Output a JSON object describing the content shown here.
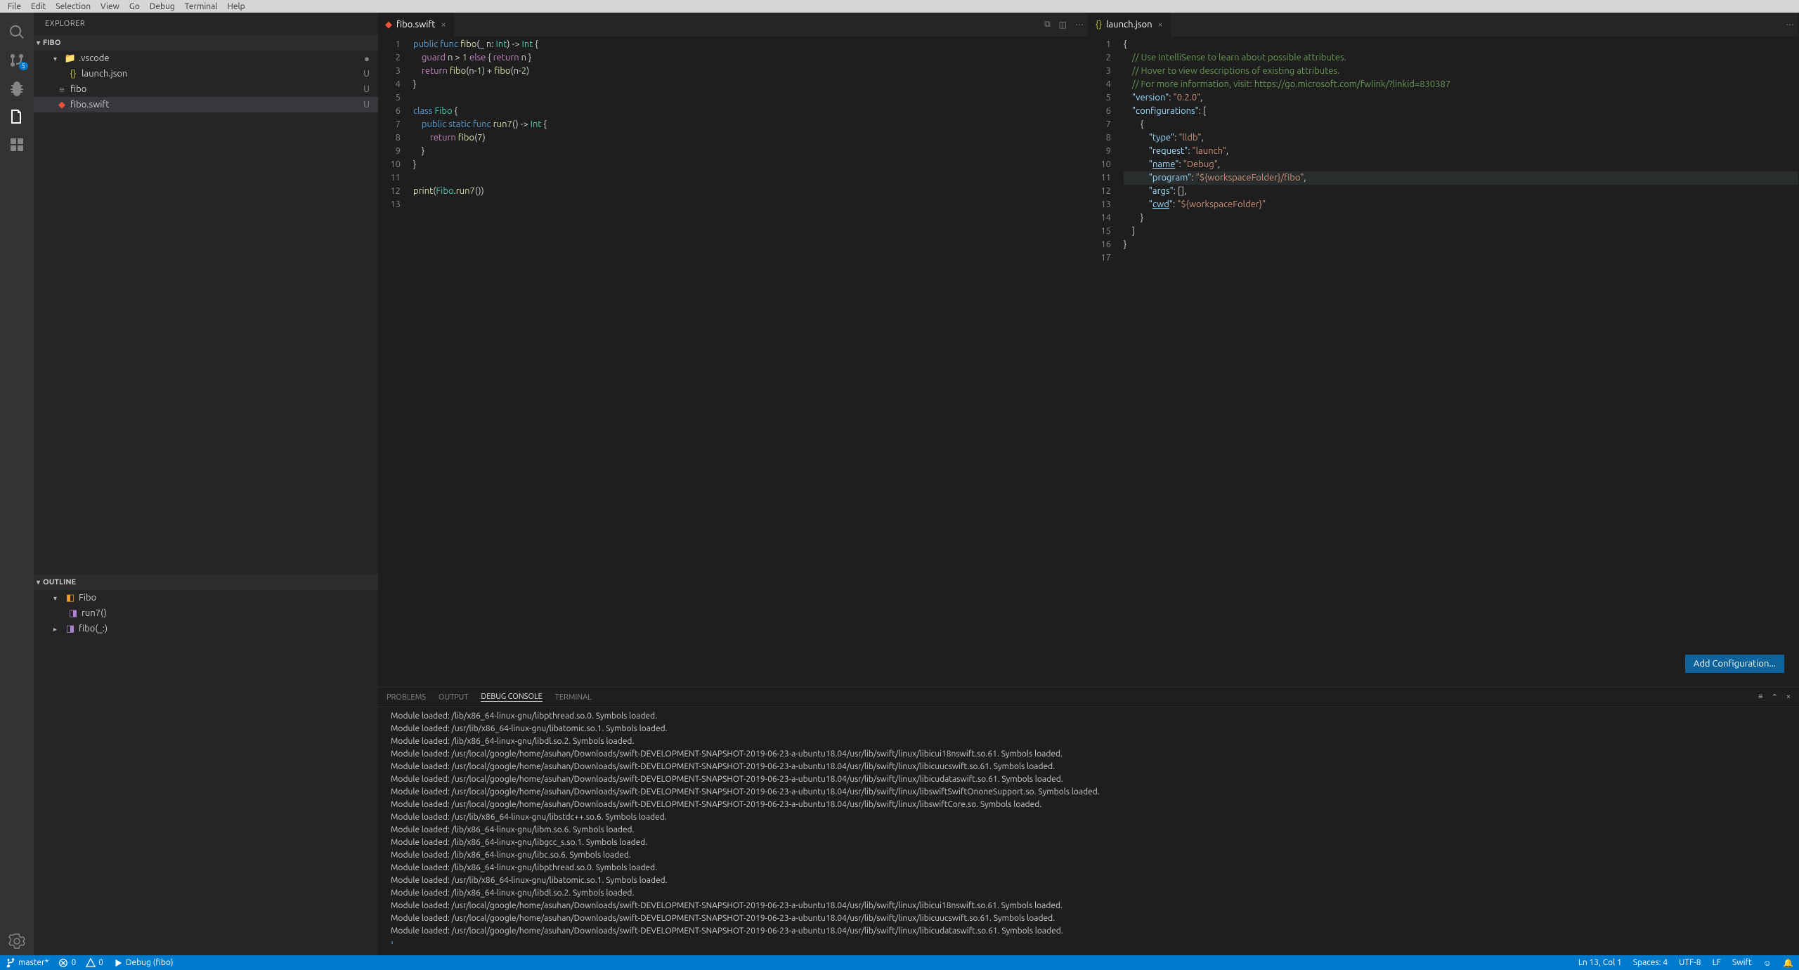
{
  "menu": [
    "File",
    "Edit",
    "Selection",
    "View",
    "Go",
    "Debug",
    "Terminal",
    "Help"
  ],
  "activityBadge": "5",
  "sidebar": {
    "title": "EXPLORER",
    "section1": "FIBO",
    "section2": "OUTLINE",
    "files": {
      "vscode": ".vscode",
      "launchjson": "launch.json",
      "fibo": "fibo",
      "fiboswift": "fibo.swift"
    },
    "outline": {
      "fibo": "Fibo",
      "run7": "run7()",
      "fibofn": "fibo(_:)"
    },
    "statusU": "U",
    "statusDot": "●"
  },
  "editor1": {
    "tab": "fibo.swift",
    "lines": [
      {
        "n": "1",
        "html": "<span class='k-blue'>public</span> <span class='k-blue'>func</span> <span class='k-func'>fibo</span>(<span class='k-ident'>_</span> n: <span class='k-type'>Int</span>) -&gt; <span class='k-type'>Int</span> {"
      },
      {
        "n": "2",
        "html": "    <span class='k-keyword'>guard</span> n &gt; <span class='k-num'>1</span> <span class='k-keyword'>else</span> { <span class='k-keyword'>return</span> n }"
      },
      {
        "n": "3",
        "html": "    <span class='k-keyword'>return</span> <span class='k-func'>fibo</span>(n-<span class='k-num'>1</span>) + <span class='k-func'>fibo</span>(n-<span class='k-num'>2</span>)"
      },
      {
        "n": "4",
        "html": "}"
      },
      {
        "n": "5",
        "html": ""
      },
      {
        "n": "6",
        "html": "<span class='k-blue'>class</span> <span class='k-type'>Fibo</span> {"
      },
      {
        "n": "7",
        "html": "    <span class='k-blue'>public</span> <span class='k-blue'>static</span> <span class='k-blue'>func</span> <span class='k-func'>run7</span>() -&gt; <span class='k-type'>Int</span> {"
      },
      {
        "n": "8",
        "html": "        <span class='k-keyword'>return</span> <span class='k-func'>fibo</span>(<span class='k-num'>7</span>)"
      },
      {
        "n": "9",
        "html": "    }"
      },
      {
        "n": "10",
        "html": "}"
      },
      {
        "n": "11",
        "html": ""
      },
      {
        "n": "12",
        "html": "<span class='k-func'>print</span>(<span class='k-type'>Fibo</span>.<span class='k-func'>run7</span>())"
      },
      {
        "n": "13",
        "html": ""
      }
    ]
  },
  "editor2": {
    "tab": "launch.json",
    "addConfig": "Add Configuration...",
    "lines": [
      {
        "n": "1",
        "html": "{"
      },
      {
        "n": "2",
        "html": "    <span class='k-comment'>// Use IntelliSense to learn about possible attributes.</span>"
      },
      {
        "n": "3",
        "html": "    <span class='k-comment'>// Hover to view descriptions of existing attributes.</span>"
      },
      {
        "n": "4",
        "html": "    <span class='k-comment'>// For more information, visit: https://go.microsoft.com/fwlink/?linkid=830387</span>"
      },
      {
        "n": "5",
        "html": "    <span class='k-ident'>\"version\"</span>: <span class='k-string'>\"0.2.0\"</span>,"
      },
      {
        "n": "6",
        "html": "    <span class='k-ident'>\"configurations\"</span>: ["
      },
      {
        "n": "7",
        "html": "        {"
      },
      {
        "n": "8",
        "html": "            <span class='k-ident'>\"type\"</span>: <span class='k-string'>\"lldb\"</span>,"
      },
      {
        "n": "9",
        "html": "            <span class='k-ident'>\"request\"</span>: <span class='k-string'>\"launch\"</span>,"
      },
      {
        "n": "10",
        "html": "            <span class='k-ident'>\"<u>name</u>\"</span>: <span class='k-string'>\"Debug\"</span>,"
      },
      {
        "n": "11",
        "html": "            <span class='k-ident'>\"program\"</span>: <span class='k-string'>\"${workspaceFolder}/fibo\"</span>,",
        "hl": true
      },
      {
        "n": "12",
        "html": "            <span class='k-ident'>\"args\"</span>: [],"
      },
      {
        "n": "13",
        "html": "            <span class='k-ident'>\"<u>cwd</u>\"</span>: <span class='k-string'>\"${workspaceFolder}\"</span>"
      },
      {
        "n": "14",
        "html": "        }"
      },
      {
        "n": "15",
        "html": "    ]"
      },
      {
        "n": "16",
        "html": "}"
      },
      {
        "n": "17",
        "html": ""
      }
    ]
  },
  "panel": {
    "tabs": [
      "PROBLEMS",
      "OUTPUT",
      "DEBUG CONSOLE",
      "TERMINAL"
    ],
    "active": 2,
    "lines": [
      "Module loaded: /lib/x86_64-linux-gnu/libpthread.so.0. Symbols loaded.",
      "Module loaded: /usr/lib/x86_64-linux-gnu/libatomic.so.1. Symbols loaded.",
      "Module loaded: /lib/x86_64-linux-gnu/libdl.so.2. Symbols loaded.",
      "Module loaded: /usr/local/google/home/asuhan/Downloads/swift-DEVELOPMENT-SNAPSHOT-2019-06-23-a-ubuntu18.04/usr/lib/swift/linux/libicui18nswift.so.61. Symbols loaded.",
      "Module loaded: /usr/local/google/home/asuhan/Downloads/swift-DEVELOPMENT-SNAPSHOT-2019-06-23-a-ubuntu18.04/usr/lib/swift/linux/libicuucswift.so.61. Symbols loaded.",
      "Module loaded: /usr/local/google/home/asuhan/Downloads/swift-DEVELOPMENT-SNAPSHOT-2019-06-23-a-ubuntu18.04/usr/lib/swift/linux/libicudataswift.so.61. Symbols loaded.",
      "Module loaded: /usr/local/google/home/asuhan/Downloads/swift-DEVELOPMENT-SNAPSHOT-2019-06-23-a-ubuntu18.04/usr/lib/swift/linux/libswiftSwiftOnoneSupport.so. Symbols loaded.",
      "Module loaded: /usr/local/google/home/asuhan/Downloads/swift-DEVELOPMENT-SNAPSHOT-2019-06-23-a-ubuntu18.04/usr/lib/swift/linux/libswiftCore.so. Symbols loaded.",
      "Module loaded: /usr/lib/x86_64-linux-gnu/libstdc++.so.6. Symbols loaded.",
      "Module loaded: /lib/x86_64-linux-gnu/libm.so.6. Symbols loaded.",
      "Module loaded: /lib/x86_64-linux-gnu/libgcc_s.so.1. Symbols loaded.",
      "Module loaded: /lib/x86_64-linux-gnu/libc.so.6. Symbols loaded.",
      "Module loaded: /lib/x86_64-linux-gnu/libpthread.so.0. Symbols loaded.",
      "Module loaded: /usr/lib/x86_64-linux-gnu/libatomic.so.1. Symbols loaded.",
      "Module loaded: /lib/x86_64-linux-gnu/libdl.so.2. Symbols loaded.",
      "Module loaded: /usr/local/google/home/asuhan/Downloads/swift-DEVELOPMENT-SNAPSHOT-2019-06-23-a-ubuntu18.04/usr/lib/swift/linux/libicui18nswift.so.61. Symbols loaded.",
      "Module loaded: /usr/local/google/home/asuhan/Downloads/swift-DEVELOPMENT-SNAPSHOT-2019-06-23-a-ubuntu18.04/usr/lib/swift/linux/libicuucswift.so.61. Symbols loaded.",
      "Module loaded: /usr/local/google/home/asuhan/Downloads/swift-DEVELOPMENT-SNAPSHOT-2019-06-23-a-ubuntu18.04/usr/lib/swift/linux/libicudataswift.so.61. Symbols loaded."
    ],
    "prompt": "᠈"
  },
  "status": {
    "branch": "master*",
    "errors": "0",
    "warnings": "0",
    "debug": "Debug (fibo)",
    "lncol": "Ln 13, Col 1",
    "spaces": "Spaces: 4",
    "enc": "UTF-8",
    "eol": "LF",
    "lang": "Swift"
  }
}
